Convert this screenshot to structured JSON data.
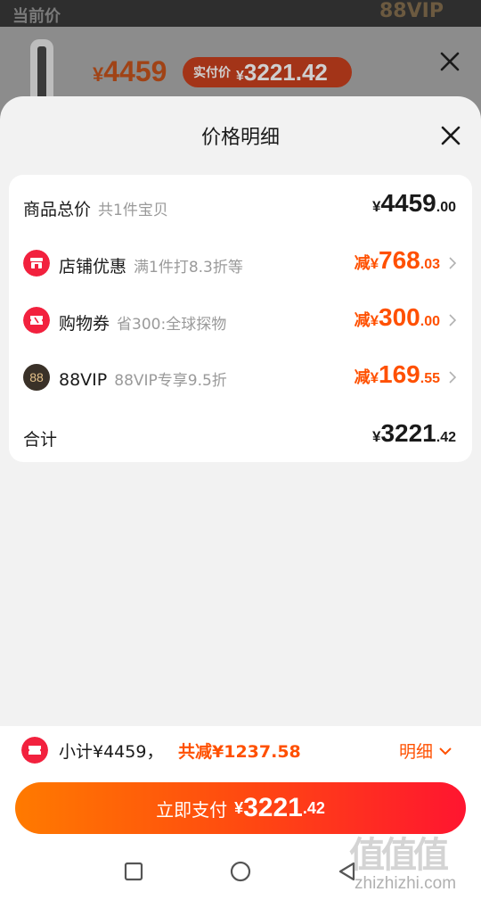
{
  "background": {
    "top_left_text": "当前价",
    "top_right_text": "88VIP",
    "price_yen": "¥",
    "price": "4459",
    "pay_label": "实付价",
    "pay_yen": "¥",
    "pay_amount": "3221.42"
  },
  "sheet": {
    "title": "价格明细"
  },
  "breakdown": {
    "total": {
      "label": "商品总价",
      "sub": "共1件宝贝",
      "yen": "¥",
      "int": "4459",
      "dec": ".00"
    },
    "rows": [
      {
        "label": "店铺优惠",
        "sub": "满1件打8.3折等",
        "prefix": "减",
        "yen": "¥",
        "int": "768",
        "dec": ".03",
        "icon": "shop-icon"
      },
      {
        "label": "购物券",
        "sub": "省300:全球探物",
        "prefix": "减",
        "yen": "¥",
        "int": "300",
        "dec": ".00",
        "icon": "coupon-icon"
      },
      {
        "label": "88VIP",
        "sub": "88VIP专享9.5折",
        "prefix": "减",
        "yen": "¥",
        "int": "169",
        "dec": ".55",
        "icon": "88vip-icon",
        "icon_text": "88"
      }
    ],
    "sum": {
      "label": "合计",
      "yen": "¥",
      "int": "3221",
      "dec": ".42"
    }
  },
  "summary": {
    "subtotal_text": "小计¥4459，",
    "saved_text": "共减¥1237.58",
    "detail_label": "明细"
  },
  "pay_button": {
    "label": "立即支付",
    "yen": "¥",
    "int": "3221",
    "dec": ".42"
  },
  "watermark": {
    "logo": "值值值",
    "text": "zhizhizhi.com"
  },
  "colors": {
    "accent": "#ff5000",
    "icon_red": "#f2213e",
    "vip_dark": "#3a3128"
  }
}
